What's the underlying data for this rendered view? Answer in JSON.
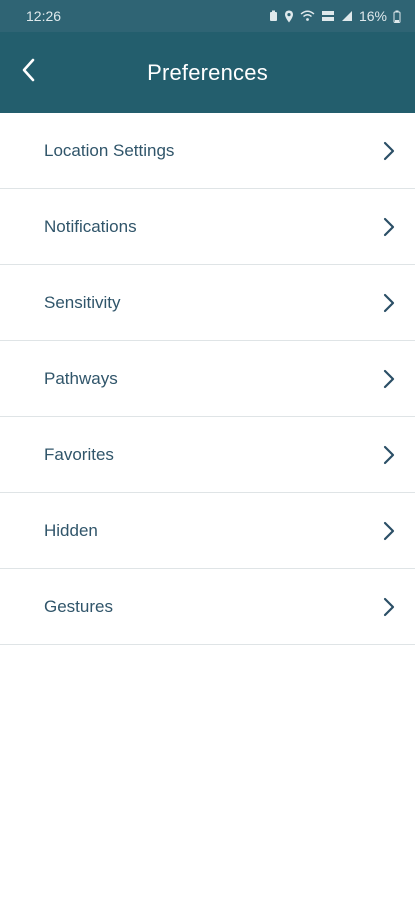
{
  "status_bar": {
    "time": "12:26",
    "battery": "16%",
    "icons": [
      "battery-saver-icon",
      "location-icon",
      "wifi-icon",
      "volte-icon",
      "signal-icon",
      "battery-icon"
    ]
  },
  "header": {
    "title": "Preferences",
    "back_icon": "chevron-left-icon"
  },
  "menu": {
    "items": [
      {
        "label": "Location Settings"
      },
      {
        "label": "Notifications"
      },
      {
        "label": "Sensitivity"
      },
      {
        "label": "Pathways"
      },
      {
        "label": "Favorites"
      },
      {
        "label": "Hidden"
      },
      {
        "label": "Gestures"
      }
    ],
    "item_icon": "chevron-right-icon"
  },
  "colors": {
    "status_bar": "#2f6474",
    "app_bar": "#235e6d",
    "label_text": "#30556a",
    "divider": "#dfe4e6"
  }
}
